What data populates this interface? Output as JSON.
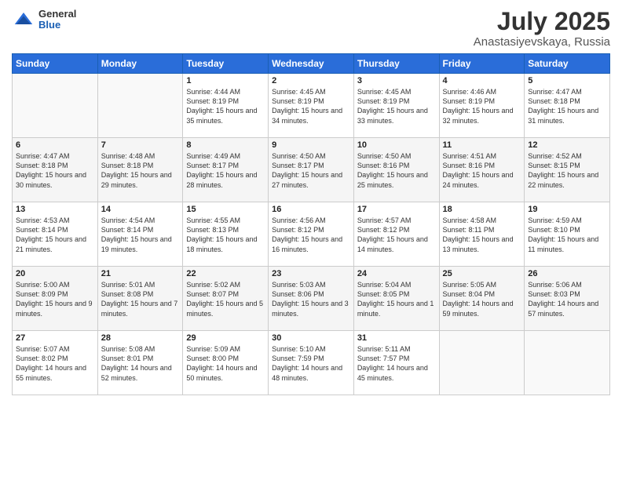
{
  "logo": {
    "general": "General",
    "blue": "Blue"
  },
  "title": "July 2025",
  "subtitle": "Anastasiyevskaya, Russia",
  "days_of_week": [
    "Sunday",
    "Monday",
    "Tuesday",
    "Wednesday",
    "Thursday",
    "Friday",
    "Saturday"
  ],
  "weeks": [
    [
      {
        "day": "",
        "sunrise": "",
        "sunset": "",
        "daylight": ""
      },
      {
        "day": "",
        "sunrise": "",
        "sunset": "",
        "daylight": ""
      },
      {
        "day": "1",
        "sunrise": "Sunrise: 4:44 AM",
        "sunset": "Sunset: 8:19 PM",
        "daylight": "Daylight: 15 hours and 35 minutes."
      },
      {
        "day": "2",
        "sunrise": "Sunrise: 4:45 AM",
        "sunset": "Sunset: 8:19 PM",
        "daylight": "Daylight: 15 hours and 34 minutes."
      },
      {
        "day": "3",
        "sunrise": "Sunrise: 4:45 AM",
        "sunset": "Sunset: 8:19 PM",
        "daylight": "Daylight: 15 hours and 33 minutes."
      },
      {
        "day": "4",
        "sunrise": "Sunrise: 4:46 AM",
        "sunset": "Sunset: 8:19 PM",
        "daylight": "Daylight: 15 hours and 32 minutes."
      },
      {
        "day": "5",
        "sunrise": "Sunrise: 4:47 AM",
        "sunset": "Sunset: 8:18 PM",
        "daylight": "Daylight: 15 hours and 31 minutes."
      }
    ],
    [
      {
        "day": "6",
        "sunrise": "Sunrise: 4:47 AM",
        "sunset": "Sunset: 8:18 PM",
        "daylight": "Daylight: 15 hours and 30 minutes."
      },
      {
        "day": "7",
        "sunrise": "Sunrise: 4:48 AM",
        "sunset": "Sunset: 8:18 PM",
        "daylight": "Daylight: 15 hours and 29 minutes."
      },
      {
        "day": "8",
        "sunrise": "Sunrise: 4:49 AM",
        "sunset": "Sunset: 8:17 PM",
        "daylight": "Daylight: 15 hours and 28 minutes."
      },
      {
        "day": "9",
        "sunrise": "Sunrise: 4:50 AM",
        "sunset": "Sunset: 8:17 PM",
        "daylight": "Daylight: 15 hours and 27 minutes."
      },
      {
        "day": "10",
        "sunrise": "Sunrise: 4:50 AM",
        "sunset": "Sunset: 8:16 PM",
        "daylight": "Daylight: 15 hours and 25 minutes."
      },
      {
        "day": "11",
        "sunrise": "Sunrise: 4:51 AM",
        "sunset": "Sunset: 8:16 PM",
        "daylight": "Daylight: 15 hours and 24 minutes."
      },
      {
        "day": "12",
        "sunrise": "Sunrise: 4:52 AM",
        "sunset": "Sunset: 8:15 PM",
        "daylight": "Daylight: 15 hours and 22 minutes."
      }
    ],
    [
      {
        "day": "13",
        "sunrise": "Sunrise: 4:53 AM",
        "sunset": "Sunset: 8:14 PM",
        "daylight": "Daylight: 15 hours and 21 minutes."
      },
      {
        "day": "14",
        "sunrise": "Sunrise: 4:54 AM",
        "sunset": "Sunset: 8:14 PM",
        "daylight": "Daylight: 15 hours and 19 minutes."
      },
      {
        "day": "15",
        "sunrise": "Sunrise: 4:55 AM",
        "sunset": "Sunset: 8:13 PM",
        "daylight": "Daylight: 15 hours and 18 minutes."
      },
      {
        "day": "16",
        "sunrise": "Sunrise: 4:56 AM",
        "sunset": "Sunset: 8:12 PM",
        "daylight": "Daylight: 15 hours and 16 minutes."
      },
      {
        "day": "17",
        "sunrise": "Sunrise: 4:57 AM",
        "sunset": "Sunset: 8:12 PM",
        "daylight": "Daylight: 15 hours and 14 minutes."
      },
      {
        "day": "18",
        "sunrise": "Sunrise: 4:58 AM",
        "sunset": "Sunset: 8:11 PM",
        "daylight": "Daylight: 15 hours and 13 minutes."
      },
      {
        "day": "19",
        "sunrise": "Sunrise: 4:59 AM",
        "sunset": "Sunset: 8:10 PM",
        "daylight": "Daylight: 15 hours and 11 minutes."
      }
    ],
    [
      {
        "day": "20",
        "sunrise": "Sunrise: 5:00 AM",
        "sunset": "Sunset: 8:09 PM",
        "daylight": "Daylight: 15 hours and 9 minutes."
      },
      {
        "day": "21",
        "sunrise": "Sunrise: 5:01 AM",
        "sunset": "Sunset: 8:08 PM",
        "daylight": "Daylight: 15 hours and 7 minutes."
      },
      {
        "day": "22",
        "sunrise": "Sunrise: 5:02 AM",
        "sunset": "Sunset: 8:07 PM",
        "daylight": "Daylight: 15 hours and 5 minutes."
      },
      {
        "day": "23",
        "sunrise": "Sunrise: 5:03 AM",
        "sunset": "Sunset: 8:06 PM",
        "daylight": "Daylight: 15 hours and 3 minutes."
      },
      {
        "day": "24",
        "sunrise": "Sunrise: 5:04 AM",
        "sunset": "Sunset: 8:05 PM",
        "daylight": "Daylight: 15 hours and 1 minute."
      },
      {
        "day": "25",
        "sunrise": "Sunrise: 5:05 AM",
        "sunset": "Sunset: 8:04 PM",
        "daylight": "Daylight: 14 hours and 59 minutes."
      },
      {
        "day": "26",
        "sunrise": "Sunrise: 5:06 AM",
        "sunset": "Sunset: 8:03 PM",
        "daylight": "Daylight: 14 hours and 57 minutes."
      }
    ],
    [
      {
        "day": "27",
        "sunrise": "Sunrise: 5:07 AM",
        "sunset": "Sunset: 8:02 PM",
        "daylight": "Daylight: 14 hours and 55 minutes."
      },
      {
        "day": "28",
        "sunrise": "Sunrise: 5:08 AM",
        "sunset": "Sunset: 8:01 PM",
        "daylight": "Daylight: 14 hours and 52 minutes."
      },
      {
        "day": "29",
        "sunrise": "Sunrise: 5:09 AM",
        "sunset": "Sunset: 8:00 PM",
        "daylight": "Daylight: 14 hours and 50 minutes."
      },
      {
        "day": "30",
        "sunrise": "Sunrise: 5:10 AM",
        "sunset": "Sunset: 7:59 PM",
        "daylight": "Daylight: 14 hours and 48 minutes."
      },
      {
        "day": "31",
        "sunrise": "Sunrise: 5:11 AM",
        "sunset": "Sunset: 7:57 PM",
        "daylight": "Daylight: 14 hours and 45 minutes."
      },
      {
        "day": "",
        "sunrise": "",
        "sunset": "",
        "daylight": ""
      },
      {
        "day": "",
        "sunrise": "",
        "sunset": "",
        "daylight": ""
      }
    ]
  ]
}
